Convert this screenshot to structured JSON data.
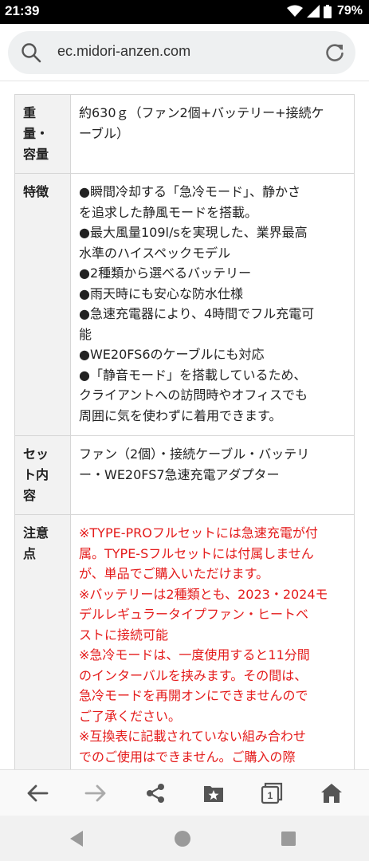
{
  "status_bar": {
    "time": "21:39",
    "battery": "79%",
    "icons": [
      "wifi-icon",
      "signal-icon",
      "battery-icon"
    ]
  },
  "browser": {
    "url": "ec.midori-anzen.com"
  },
  "spec_table": {
    "rows": [
      {
        "header": "重量・容量",
        "header_lines": [
          "重",
          "量・",
          "容量"
        ],
        "lines": [
          "約630ｇ（ファン2個+バッテリー+接続ケ",
          "ーブル）"
        ]
      },
      {
        "header": "特徴",
        "header_lines": [
          "特徴"
        ],
        "lines": [
          "●瞬間冷却する「急冷モード」、静かさ",
          "を追求した静風モードを搭載。",
          "●最大風量109l/sを実現した、業界最高",
          "水準のハイスペックモデル",
          "●2種類から選べるバッテリー",
          "●雨天時にも安心な防水仕様",
          "●急速充電器により、4時間でフル充電可",
          "能",
          "●WE20FS6のケーブルにも対応",
          "●「静音モード」を搭載しているため、",
          "クライアントへの訪問時やオフィスでも",
          "周囲に気を使わずに着用できます。"
        ]
      },
      {
        "header": "セット内容",
        "header_lines": [
          "セッ",
          "ト内",
          "容"
        ],
        "lines": [
          "ファン（2個）・接続ケーブル・バッテリ",
          "ー・WE20FS7急速充電アダプター"
        ]
      },
      {
        "header": "注意点",
        "header_lines": [
          "注意",
          "点"
        ],
        "lines": [
          "※TYPE-PROフルセットには急速充電が付",
          "属。TYPE-Sフルセットには付属しません",
          "が、単品でご購入いただけます。",
          "※バッテリーは2種類とも、2023・2024モ",
          "デルレギュラータイプファン・ヒートベ",
          "ストに接続可能",
          "※急冷モードは、一度使用すると11分間",
          "のインターバルを挟みます。その間は、",
          "急冷モードを再開オンにできませんので",
          "ご了承ください。",
          "※互換表に記載されていない組み合わせ",
          "でのご使用はできません。ご購入の際"
        ]
      }
    ]
  },
  "toolbar": {
    "tab_count": "1",
    "buttons": [
      "back-icon",
      "forward-icon",
      "share-icon",
      "bookmark-icon",
      "tabs-icon",
      "home-icon"
    ]
  },
  "nav_bar": {
    "buttons": [
      "nav-back-icon",
      "nav-home-icon",
      "nav-recents-icon"
    ]
  },
  "colors": {
    "warning_text": "#e41b1b",
    "header_cell_bg": "#f2f2f2",
    "border": "#d6d6d6"
  }
}
